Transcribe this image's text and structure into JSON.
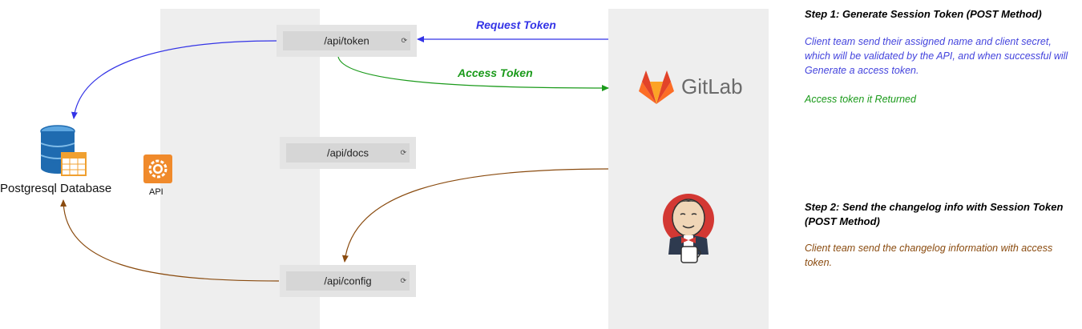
{
  "colors": {
    "request": "#3333e6",
    "access": "#1a9a1a",
    "changelog": "#8a4b0f",
    "gitlab_text": "#6b6b6b",
    "jenkins_red": "#d33833",
    "api_icon": "#f08a2b",
    "db_blue": "#1f6bb0"
  },
  "database": {
    "label": "Postgresql Database",
    "icon": "database-table-icon"
  },
  "api": {
    "label": "API",
    "icon": "gear-api-icon"
  },
  "endpoints": [
    {
      "label": "/api/token",
      "icon": "refresh-icon"
    },
    {
      "label": "/api/docs",
      "icon": "refresh-icon"
    },
    {
      "label": "/api/config",
      "icon": "refresh-icon"
    }
  ],
  "edges": {
    "request": "Request Token",
    "access": "Access Token"
  },
  "gitlab": {
    "label": "GitLab",
    "icon": "gitlab-fox-icon"
  },
  "jenkins": {
    "icon": "jenkins-butler-icon"
  },
  "notes": {
    "step1_title": "Step 1: Generate Session Token (POST Method)",
    "step1_text": "Client team send their assigned name and client secret, which will be validated by the API, and when successful will Generate a access token.",
    "step1_result": "Access token it Returned",
    "step2_title": "Step 2: Send the changelog info with Session Token (POST Method)",
    "step2_text": "Client team send the changelog information with access token."
  }
}
